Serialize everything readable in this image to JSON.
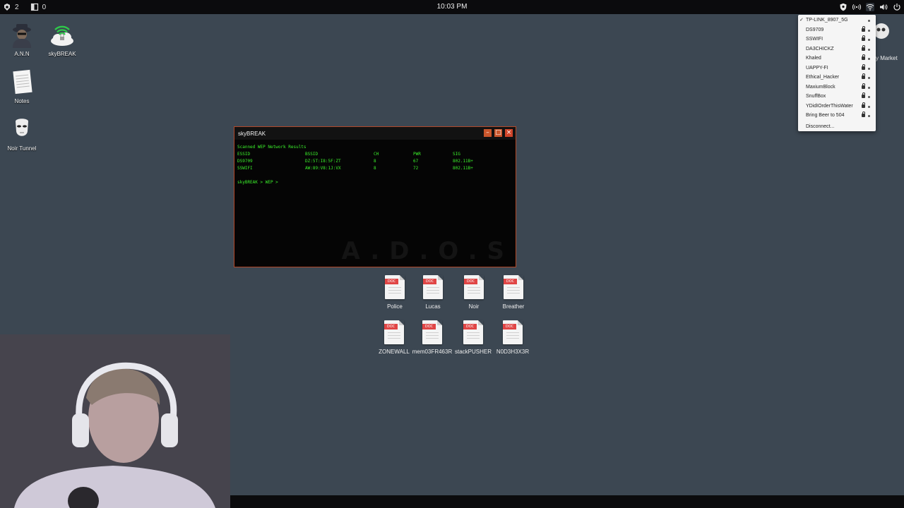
{
  "topbar": {
    "left_counter_1": "2",
    "left_counter_2": "0",
    "clock": "10:03 PM",
    "icons": [
      "shield-icon",
      "broadcast-icon",
      "wifi-icon",
      "volume-icon",
      "power-icon"
    ]
  },
  "desktop": {
    "icons": [
      {
        "label": "A.N.N"
      },
      {
        "label": "skyBREAK"
      },
      {
        "label": "Notes"
      },
      {
        "label": "Noir Tunnel"
      }
    ],
    "partial_icon_label": "y Market"
  },
  "window": {
    "title": "skyBREAK",
    "heading": "Scanned WEP Network Results",
    "columns": [
      "ESSID",
      "BSSID",
      "CH",
      "PWR",
      "SIG"
    ],
    "rows": [
      [
        "DS9709",
        "DZ:5T:I8:5F:ZT",
        "8",
        "67",
        "802.11B+"
      ],
      [
        "SSWIFI",
        "AW:89:V8:1J:VX",
        "8",
        "72",
        "802.11B+"
      ]
    ],
    "prompt": "skyBREAK > WEP >",
    "watermark": "A.D.O.S"
  },
  "files": [
    {
      "tag": "DOC",
      "label": "Police"
    },
    {
      "tag": "DOC",
      "label": "Lucas"
    },
    {
      "tag": "DOC",
      "label": "Noir"
    },
    {
      "tag": "DOC",
      "label": "Breather"
    },
    {
      "tag": "DOC",
      "label": "ZONEWALL"
    },
    {
      "tag": "DOC",
      "label": "mem03FR463R"
    },
    {
      "tag": "DOC",
      "label": "stackPUSHER"
    },
    {
      "tag": "DOC",
      "label": "N0D3H3X3R"
    }
  ],
  "wifi_menu": {
    "networks": [
      {
        "name": "TP-LINK_8907_5G",
        "connected": true
      },
      {
        "name": "DS9709"
      },
      {
        "name": "SSWIFI"
      },
      {
        "name": "DA3CHICKZ"
      },
      {
        "name": "Khaled"
      },
      {
        "name": "UAPPY-FI"
      },
      {
        "name": "Ethical_Hacker"
      },
      {
        "name": "MaxiumBlock"
      },
      {
        "name": "SnuffBox"
      },
      {
        "name": "YDidIOrderThisWater"
      },
      {
        "name": "Bring Beer to 504"
      }
    ],
    "disconnect_label": "Disconnect..."
  },
  "colors": {
    "desktop_bg": "#3c4752",
    "terminal_text": "#3bf02b",
    "window_border": "#b2492a",
    "doc_tag": "#e04545"
  }
}
